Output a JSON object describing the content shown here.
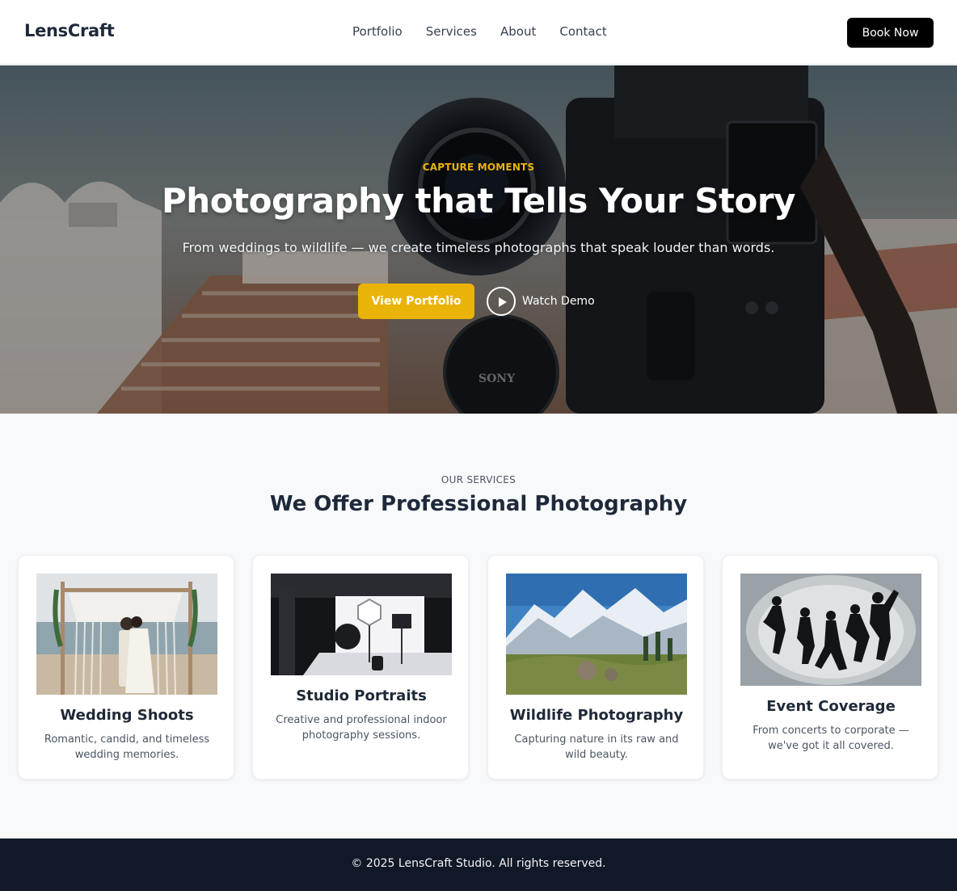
{
  "brand": "LensCraft",
  "nav": {
    "links": [
      "Portfolio",
      "Services",
      "About",
      "Contact"
    ],
    "cta": "Book Now"
  },
  "hero": {
    "kicker": "CAPTURE MOMENTS",
    "title": "Photography that Tells Your Story",
    "subtitle": "From weddings to wildlife — we create timeless photographs that speak louder than words.",
    "primary_button": "View Portfolio",
    "secondary_button": "Watch Demo",
    "accent_color": "#eab308"
  },
  "services": {
    "kicker": "OUR SERVICES",
    "title": "We Offer Professional Photography",
    "cards": [
      {
        "title": "Wedding Shoots",
        "description": "Romantic, candid, and timeless wedding memories."
      },
      {
        "title": "Studio Portraits",
        "description": "Creative and professional indoor photography sessions."
      },
      {
        "title": "Wildlife Photography",
        "description": "Capturing nature in its raw and wild beauty."
      },
      {
        "title": "Event Coverage",
        "description": "From concerts to corporate — we've got it all covered."
      }
    ]
  },
  "footer": {
    "text": "© 2025 LensCraft Studio. All rights reserved."
  },
  "colors": {
    "accent": "#eab308",
    "dark": "#111827",
    "button_dark": "#000000"
  }
}
